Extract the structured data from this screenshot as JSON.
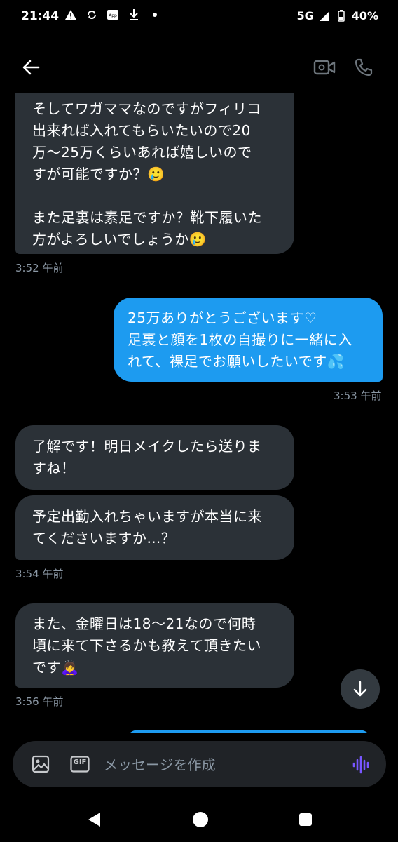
{
  "status_bar": {
    "time": "21:44",
    "network": "5G",
    "battery": "40%",
    "icons": [
      "warning-icon",
      "sync-icon",
      "app-notification-icon",
      "download-icon",
      "dot-icon"
    ]
  },
  "header": {
    "icons": [
      "back-arrow-icon",
      "video-call-icon",
      "phone-call-icon"
    ]
  },
  "messages": [
    {
      "direction": "in",
      "text": "そしてワガママなのですがフィリコ\n出来れば入れてもらいたいので20\n万〜25万くらいあれば嬉しいので\nすが可能ですか？🥲\n\nまた足裏は素足ですか？靴下履いた\n方がよろしいでしょうか🥲"
    },
    {
      "direction": "in-time",
      "text": "3:52 午前"
    },
    {
      "direction": "out",
      "text": "25万ありがとうございます♡\n足裏と顔を1枚の自撮りに一緒に入\nれて、裸足でお願いしたいです💦"
    },
    {
      "direction": "out-time",
      "text": "3:53 午前"
    },
    {
      "direction": "in",
      "text": "了解です！明日メイクしたら送りま\nすね！"
    },
    {
      "direction": "in",
      "text": "予定出勤入れちゃいますが本当に来\nてくださいますか…？"
    },
    {
      "direction": "in-time",
      "text": "3:54 午前"
    },
    {
      "direction": "in",
      "text": "また、金曜日は18〜21なので何時\n頃に来て下さるかも教えて頂きたい\nです🙇‍♀️"
    },
    {
      "direction": "in-time",
      "text": "3:56 午前"
    }
  ],
  "composer": {
    "placeholder": "メッセージを作成",
    "gif_label": "GIF",
    "icons": [
      "image-icon",
      "gif-icon",
      "voice-icon"
    ]
  },
  "nav_bar": {
    "icons": [
      "nav-back-icon",
      "nav-home-icon",
      "nav-recent-icon"
    ]
  },
  "colors": {
    "background": "#000000",
    "incoming_bubble": "#2b3137",
    "outgoing_bubble": "#1d9bf0",
    "timestamp": "#8b98a5",
    "accent_voice": "#7856ff"
  }
}
